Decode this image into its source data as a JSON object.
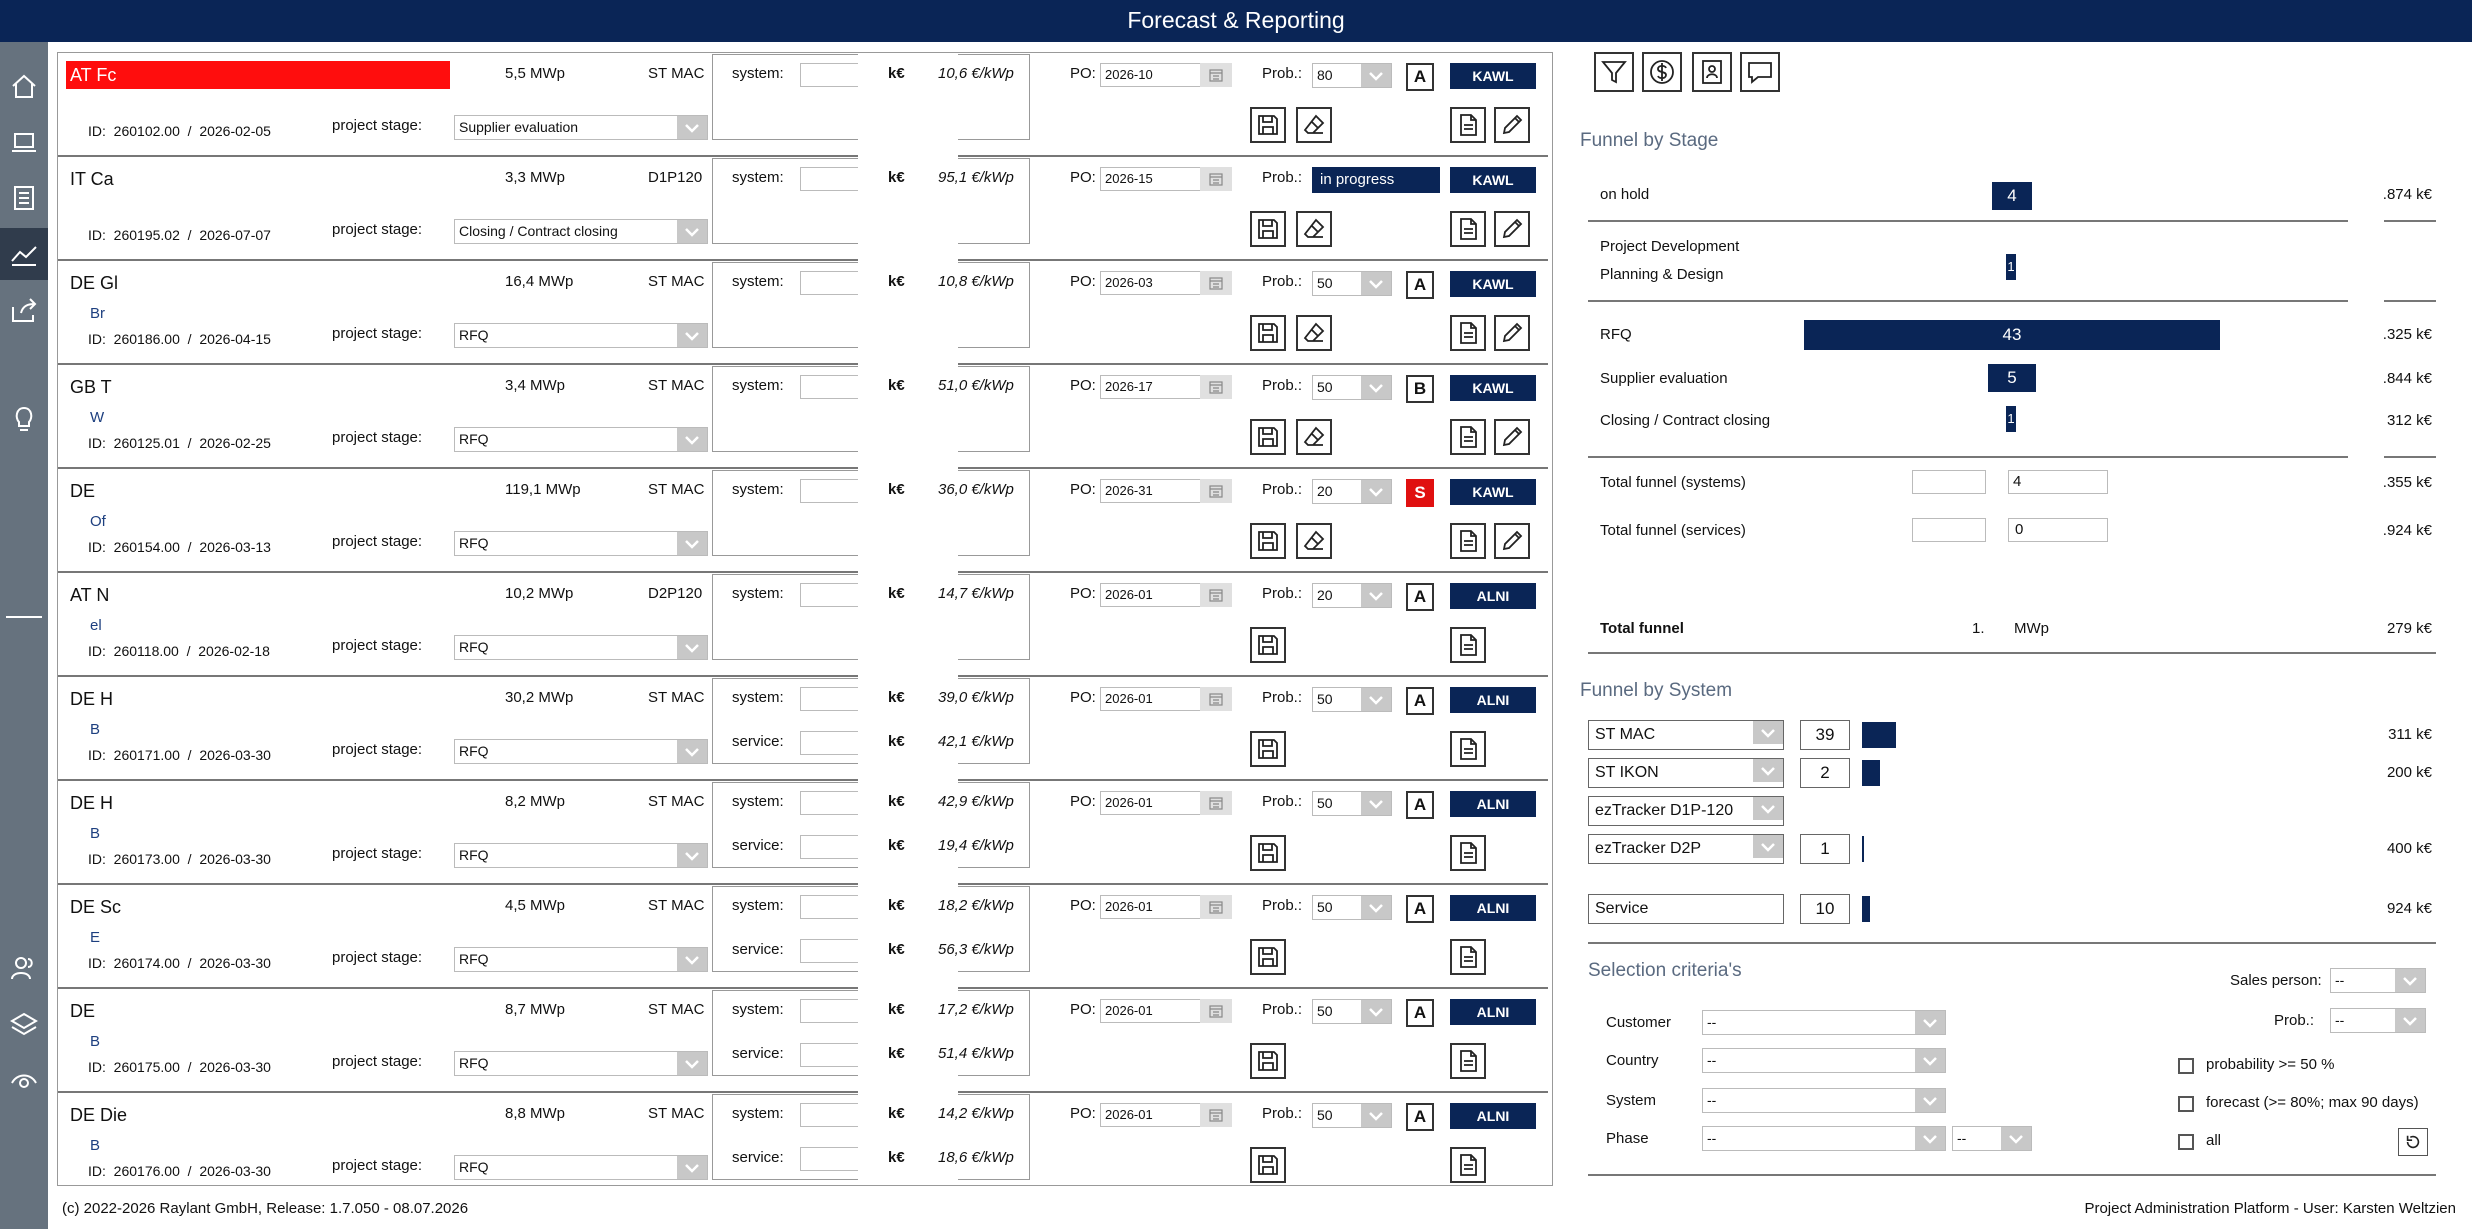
{
  "header": {
    "title": "Forecast & Reporting"
  },
  "labels": {
    "id": "ID:",
    "stage": "project stage:",
    "system": "system:",
    "service": "service:",
    "keur": "k€",
    "eurkwp": "€/kWp",
    "po": "PO:",
    "prob": "Prob.:"
  },
  "projects": [
    {
      "name": "AT Fc",
      "sub": "",
      "id": "260102.00",
      "date": "2026-02-05",
      "mwp": "5,5 MWp",
      "system": "ST MAC",
      "stage": "Supplier evaluation",
      "sys_k": "",
      "sys_kwp": "10,6",
      "svc_k": "",
      "svc_kwp": "",
      "po": "2026-10",
      "prob": "80",
      "grade": "A",
      "owner": "KAWL",
      "red_name": true
    },
    {
      "name": "IT Ca",
      "sub": "",
      "id": "260195.02",
      "date": "2026-07-07",
      "mwp": "3,3 MWp",
      "system": "D1P120",
      "stage": "Closing / Contract closing",
      "sys_k": "",
      "sys_kwp": "95,1",
      "svc_k": "",
      "svc_kwp": "",
      "po": "2026-15",
      "prob": "in progress",
      "grade": "",
      "owner": "KAWL"
    },
    {
      "name": "DE Gl",
      "sub": "Br",
      "id": "260186.00",
      "date": "2026-04-15",
      "mwp": "16,4 MWp",
      "system": "ST MAC",
      "stage": "RFQ",
      "sys_k": "",
      "sys_kwp": "10,8",
      "svc_k": "",
      "svc_kwp": "",
      "po": "2026-03",
      "prob": "50",
      "grade": "A",
      "owner": "KAWL"
    },
    {
      "name": "GB T",
      "sub": "W",
      "id": "260125.01",
      "date": "2026-02-25",
      "mwp": "3,4 MWp",
      "system": "ST MAC",
      "stage": "RFQ",
      "sys_k": "",
      "sys_kwp": "51,0",
      "svc_k": "",
      "svc_kwp": "",
      "po": "2026-17",
      "prob": "50",
      "grade": "B",
      "owner": "KAWL"
    },
    {
      "name": "DE",
      "sub": "Of",
      "id": "260154.00",
      "date": "2026-03-13",
      "mwp": "119,1 MWp",
      "system": "ST MAC",
      "stage": "RFQ",
      "sys_k": "",
      "sys_kwp": "36,0",
      "svc_k": "",
      "svc_kwp": "",
      "po": "2026-31",
      "prob": "20",
      "grade": "S",
      "owner": "KAWL"
    },
    {
      "name": "AT N",
      "sub": "el",
      "id": "260118.00",
      "date": "2026-02-18",
      "mwp": "10,2 MWp",
      "system": "D2P120",
      "stage": "RFQ",
      "sys_k": "",
      "sys_kwp": "14,7",
      "svc_k": "",
      "svc_kwp": "",
      "po": "2026-01",
      "prob": "20",
      "grade": "A",
      "owner": "ALNI"
    },
    {
      "name": "DE H",
      "sub": "B",
      "id": "260171.00",
      "date": "2026-03-30",
      "mwp": "30,2 MWp",
      "system": "ST MAC",
      "stage": "RFQ",
      "sys_k": "",
      "sys_kwp": "39,0",
      "svc_k": "",
      "svc_kwp": "42,1",
      "po": "2026-01",
      "prob": "50",
      "grade": "A",
      "owner": "ALNI"
    },
    {
      "name": "DE H",
      "sub": "B",
      "id": "260173.00",
      "date": "2026-03-30",
      "mwp": "8,2 MWp",
      "system": "ST MAC",
      "stage": "RFQ",
      "sys_k": "",
      "sys_kwp": "42,9",
      "svc_k": "",
      "svc_kwp": "19,4",
      "po": "2026-01",
      "prob": "50",
      "grade": "A",
      "owner": "ALNI"
    },
    {
      "name": "DE Sc",
      "sub": "E",
      "id": "260174.00",
      "date": "2026-03-30",
      "mwp": "4,5 MWp",
      "system": "ST MAC",
      "stage": "RFQ",
      "sys_k": "",
      "sys_kwp": "18,2",
      "svc_k": "",
      "svc_kwp": "56,3",
      "po": "2026-01",
      "prob": "50",
      "grade": "A",
      "owner": "ALNI"
    },
    {
      "name": "DE",
      "sub": "B",
      "id": "260175.00",
      "date": "2026-03-30",
      "mwp": "8,7 MWp",
      "system": "ST MAC",
      "stage": "RFQ",
      "sys_k": "",
      "sys_kwp": "17,2",
      "svc_k": "",
      "svc_kwp": "51,4",
      "po": "2026-01",
      "prob": "50",
      "grade": "A",
      "owner": "ALNI"
    },
    {
      "name": "DE Die",
      "sub": "B",
      "id": "260176.00",
      "date": "2026-03-30",
      "mwp": "8,8 MWp",
      "system": "ST MAC",
      "stage": "RFQ",
      "sys_k": "",
      "sys_kwp": "14,2",
      "svc_k": "",
      "svc_kwp": "18,6",
      "po": "2026-01",
      "prob": "50",
      "grade": "A",
      "owner": "ALNI"
    }
  ],
  "funnel": {
    "title": "Funnel by Stage",
    "onhold": {
      "label": "on hold",
      "count": "4",
      "value": ".874 k€"
    },
    "pd": {
      "label1": "Project Development",
      "label2": "Planning & Design",
      "count": "1",
      "value": ""
    },
    "rfq": {
      "label": "RFQ",
      "count": "43",
      "value": ".325 k€"
    },
    "se": {
      "label": "Supplier evaluation",
      "count": "5",
      "value": ".844 k€"
    },
    "cc": {
      "label": "Closing / Contract closing",
      "count": "1",
      "value": "312 k€"
    },
    "tsys": {
      "label": "Total funnel (systems)",
      "count": "4",
      "value": ".355 k€"
    },
    "tsvc": {
      "label": "Total funnel (services)",
      "count": "0",
      "value": ".924 k€"
    },
    "total": {
      "label": "Total funnel",
      "mwp_num": "1.",
      "mwp_unit": "MWp",
      "value": "279 k€"
    }
  },
  "systems": {
    "title": "Funnel by System",
    "items": [
      {
        "name": "ST MAC",
        "count": "39",
        "value": "311 k€"
      },
      {
        "name": "ST IKON",
        "count": "2",
        "value": "200 k€"
      },
      {
        "name": "ezTracker D1P-120",
        "count": "",
        "value": ""
      },
      {
        "name": "ezTracker D2P",
        "count": "1",
        "value": "400 k€"
      }
    ],
    "service": {
      "name": "Service",
      "count": "10",
      "value": "924 k€"
    }
  },
  "criteria": {
    "title": "Selection criteria's",
    "customer": "Customer",
    "country": "Country",
    "system": "System",
    "phase": "Phase",
    "empty": "--",
    "sales": "Sales person:",
    "prob": "Prob.:",
    "p50": "probability >= 50 %",
    "forecast": "forecast (>= 80%; max 90 days)",
    "all": "all"
  },
  "footer": {
    "left": "(c) 2022-2026 Raylant GmbH, Release: 1.7.050  -  08.07.2026",
    "right": "Project Administration Platform - User: Karsten Weltzien"
  },
  "colors": {
    "navy": "#0a2556",
    "red": "#ff0d0d",
    "sidebar": "#66727e"
  }
}
